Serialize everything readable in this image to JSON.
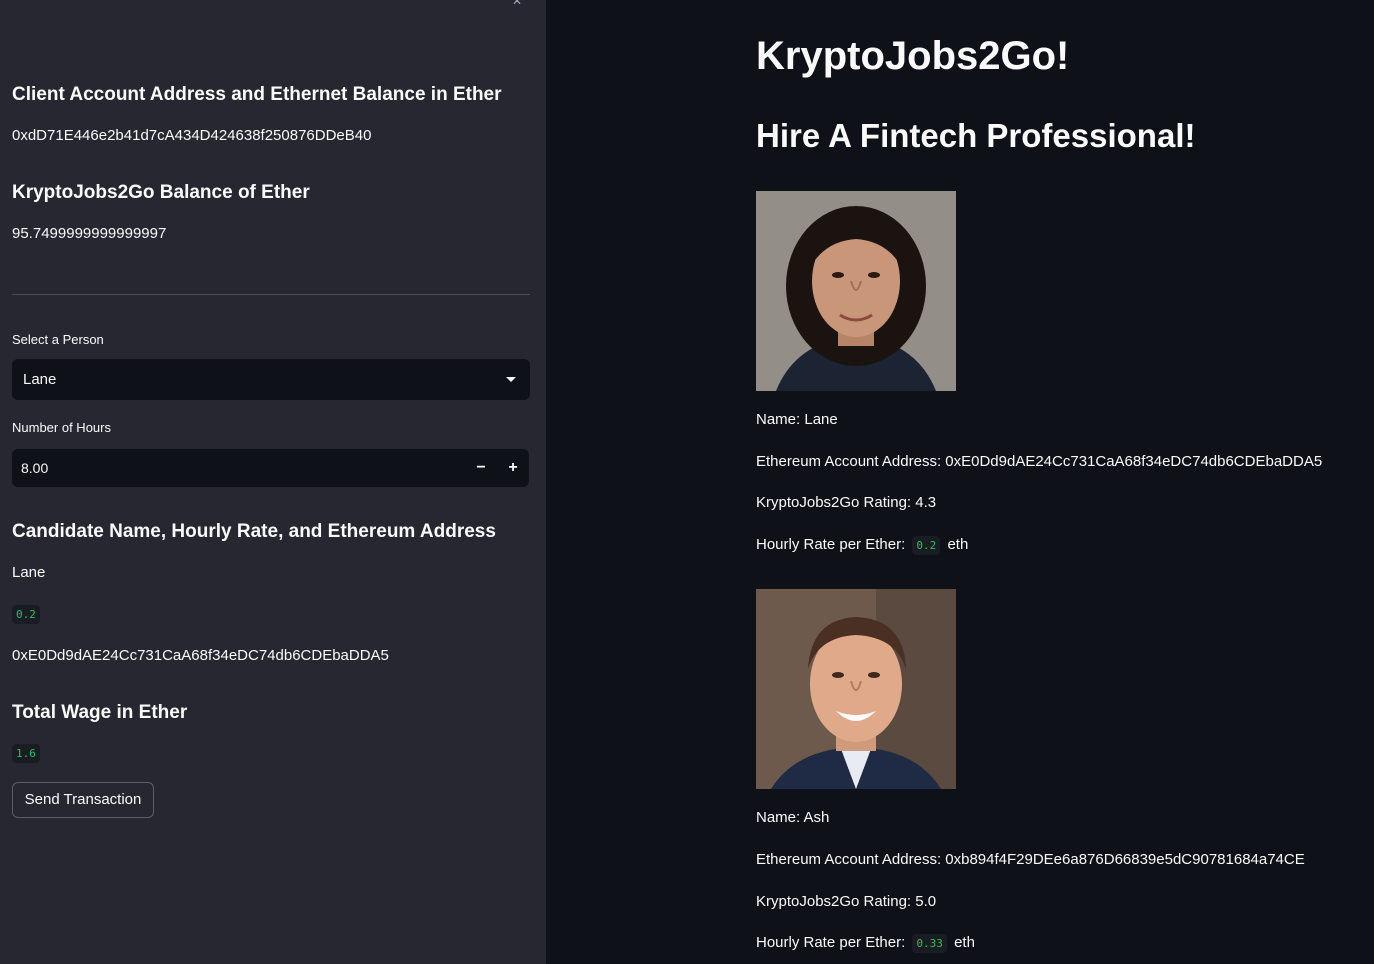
{
  "sidebar": {
    "client_heading": "Client Account Address and Ethernet Balance in Ether",
    "client_address": "0xdD71E446e2b41d7cA434D424638f250876DDeB40",
    "balance_heading": "KryptoJobs2Go Balance of Ether",
    "balance_value": "95.7499999999999997",
    "select_label": "Select a Person",
    "select_value": "Lane",
    "hours_label": "Number of Hours",
    "hours_value": "8.00",
    "minus": "−",
    "plus": "+",
    "candidate_heading": "Candidate Name, Hourly Rate, and Ethereum Address",
    "candidate_name": "Lane",
    "candidate_rate": "0.2",
    "candidate_address": "0xE0Dd9dAE24Cc731CaA68f34eDC74db6CDEbaDDA5",
    "wage_heading": "Total Wage in Ether",
    "wage_value": "1.6",
    "send_button": "Send Transaction"
  },
  "main": {
    "title": "KryptoJobs2Go!",
    "subtitle": "Hire A Fintech Professional!",
    "candidates": [
      {
        "name": "Name: Lane",
        "address": "Ethereum Account Address: 0xE0Dd9dAE24Cc731CaA68f34eDC74db6CDEbaDDA5",
        "rating": "KryptoJobs2Go Rating: 4.3",
        "rate_label": "Hourly Rate per Ether:",
        "rate_value": "0.2",
        "rate_unit": "eth"
      },
      {
        "name": "Name: Ash",
        "address": "Ethereum Account Address: 0xb894f4F29DEe6a876D66839e5dC90781684a74CE",
        "rating": "KryptoJobs2Go Rating: 5.0",
        "rate_label": "Hourly Rate per Ether:",
        "rate_value": "0.33",
        "rate_unit": "eth"
      }
    ]
  },
  "colors": {
    "sidebar_bg": "#262730",
    "main_bg": "#0e1117",
    "code_green": "#21c354"
  }
}
